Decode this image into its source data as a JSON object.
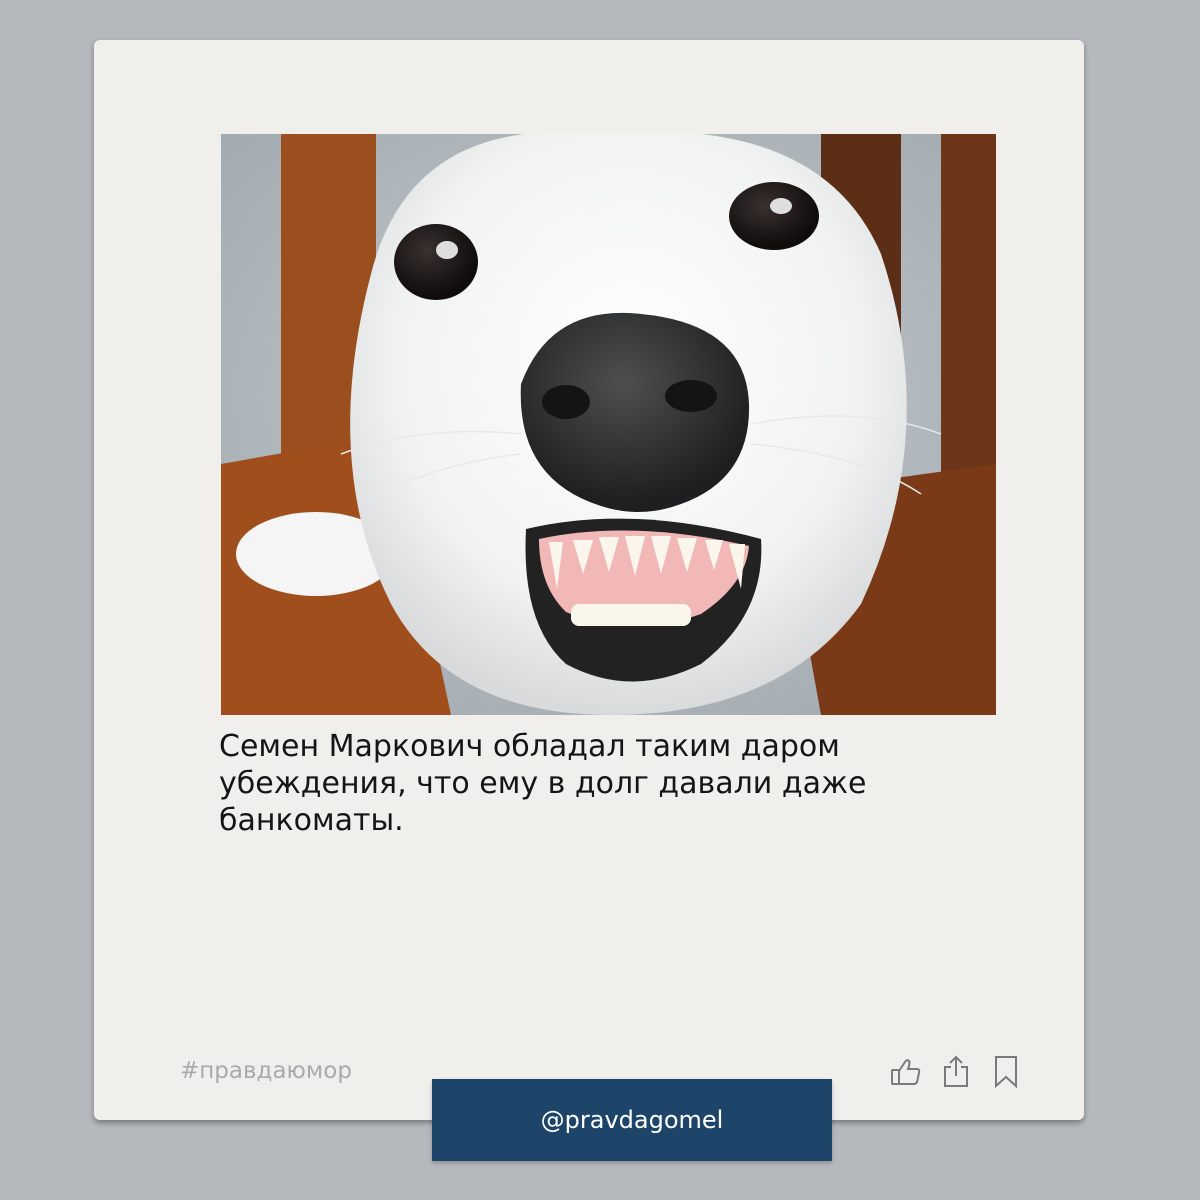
{
  "post": {
    "caption": "Семен Маркович обладал таким даром убеждения, что ему в долг давали даже банкоматы.",
    "hashtag": "#правдаюмор",
    "handle": "@pravdagomel"
  },
  "photo": {
    "subject": "smiling white dog close-up"
  },
  "actions": {
    "icons": [
      "thumbs-up-icon",
      "share-icon",
      "bookmark-icon"
    ]
  },
  "colors": {
    "background": "#b5b9be",
    "card": "#f0efec",
    "handle_button": "#1d4569",
    "hashtag_text": "#aaaaaa",
    "icon_stroke": "#7a7a7a"
  }
}
